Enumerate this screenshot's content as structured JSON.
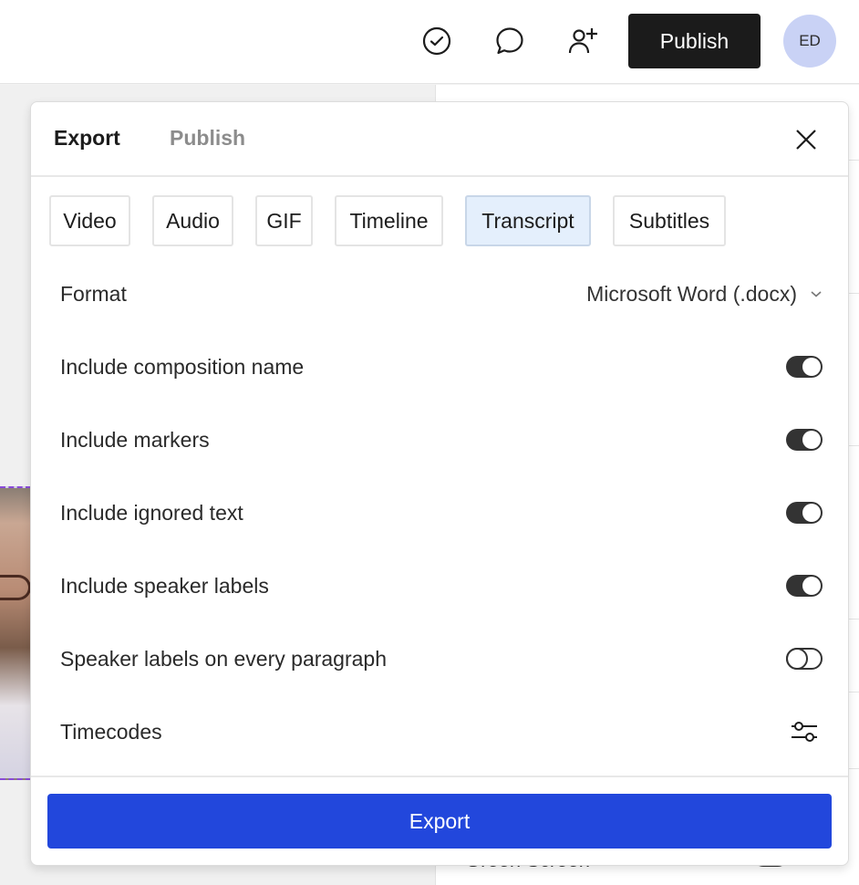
{
  "topbar": {
    "icons": [
      "check-circle-icon",
      "comment-icon",
      "add-user-icon"
    ],
    "publish_label": "Publish",
    "avatar_initials": "ED"
  },
  "background": {
    "right_panel_bottom_label": "Green Screen"
  },
  "modal": {
    "tabs": [
      {
        "label": "Export",
        "active": true
      },
      {
        "label": "Publish",
        "active": false
      }
    ],
    "export_types": [
      {
        "label": "Video",
        "selected": false
      },
      {
        "label": "Audio",
        "selected": false
      },
      {
        "label": "GIF",
        "selected": false
      },
      {
        "label": "Timeline",
        "selected": false
      },
      {
        "label": "Transcript",
        "selected": true
      },
      {
        "label": "Subtitles",
        "selected": false
      }
    ],
    "format": {
      "label": "Format",
      "value": "Microsoft Word (.docx)"
    },
    "options": [
      {
        "label": "Include composition name",
        "enabled": true
      },
      {
        "label": "Include markers",
        "enabled": true
      },
      {
        "label": "Include ignored text",
        "enabled": true
      },
      {
        "label": "Include speaker labels",
        "enabled": true
      },
      {
        "label": "Speaker labels on every paragraph",
        "enabled": false
      }
    ],
    "timecodes": {
      "label": "Timecodes",
      "icon": "sliders-icon"
    },
    "export_label": "Export"
  },
  "colors": {
    "primary": "#2247dc",
    "dark_button": "#1b1b1b",
    "avatar_bg": "#c9d2f5",
    "selected_tab_bg": "#e4effc"
  }
}
